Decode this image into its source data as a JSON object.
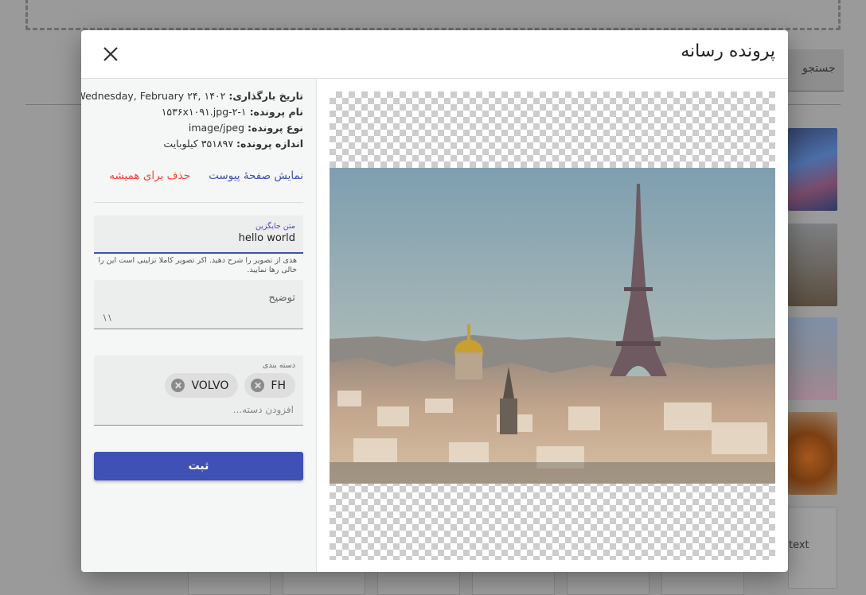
{
  "background": {
    "search_label": "جستجو",
    "broken_image_alt": "text"
  },
  "modal": {
    "title": "پرونده رسانه",
    "close_icon": "close-icon"
  },
  "file_info": {
    "upload_date_label": "تاریخ بارگذاری:",
    "upload_date_value": "Wednesday, February ۲۴, ۱۴۰۲",
    "file_name_label": "نام پرونده:",
    "file_name_value": "۱۵۳۶x۱۰۹۱.jpg-۲-۱",
    "file_type_label": "نوع پرونده:",
    "file_type_value": "image/jpeg",
    "file_size_label": "اندازه پرونده:",
    "file_size_value": "۳۵۱۸۹۷ کیلوبایت"
  },
  "actions": {
    "view_attachment": "نمایش صفحهٔ پیوست",
    "delete_forever": "حذف برای همیشه"
  },
  "form": {
    "alt_label": "متن جایگزین",
    "alt_value": "hello world",
    "alt_hint": "هدی از تصویر را شرح دهید. اکر تصویر کاملا تزلینی است این را خالی رها نمایید.",
    "description_label": "توضیح",
    "categories_label": "دسته بندی",
    "categories": [
      "FH",
      "VOLVO"
    ],
    "categories_placeholder": "افزودن دسته...",
    "submit_label": "ثبت"
  },
  "colors": {
    "primary": "#3f51b5",
    "danger": "#f44336"
  }
}
